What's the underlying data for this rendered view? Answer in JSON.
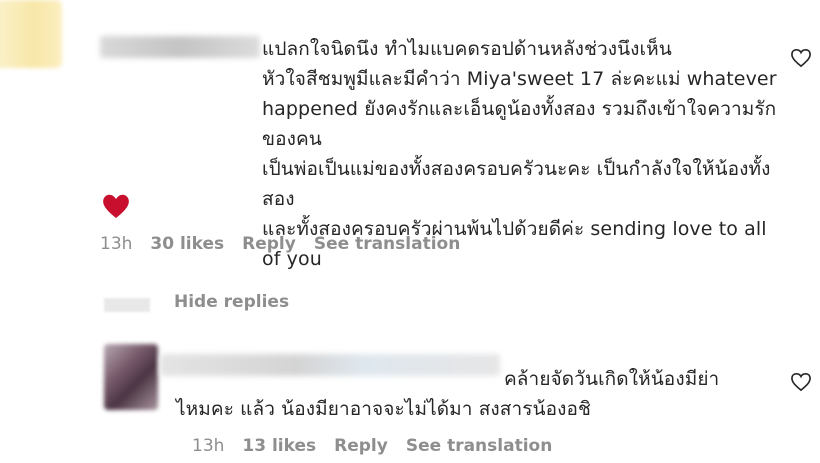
{
  "comments": [
    {
      "text": "แปลกใจนิดนึง ทำไมแบคดรอปด้านหลังช่วงนึงเห็น\nหัวใจสีชมพูมีและมีคำว่า Miya'sweet 17 ล่ะคะแม่ whatever\nhappened ยังคงรักและเอ็นดูน้องทั้งสอง รวมถึงเข้าใจความรักของคน\nเป็นพ่อเป็นแม่ของทั้งสองครอบครัวนะคะ เป็นกำลังใจให้น้องทั้งสอง\nและทั้งสองครอบครัวผ่านพ้นไปด้วยดีค่ะ sending love to all of you",
      "time": "13h",
      "likes": "30 likes",
      "reply_label": "Reply",
      "translate_label": "See translation",
      "emoji": "red-heart-emoji"
    },
    {
      "text": "คล้ายจัดวันเกิดให้น้องมีย่า\nไหมคะ แล้ว น้องมียาอาจจะไม่ได้มา สงสารน้องอชิ",
      "time": "13h",
      "likes": "13 likes",
      "reply_label": "Reply",
      "translate_label": "See translation"
    }
  ],
  "hide_replies_label": "Hide replies",
  "colors": {
    "heart": "#c8102e",
    "muted": "#8e8e8e",
    "text": "#262626"
  }
}
